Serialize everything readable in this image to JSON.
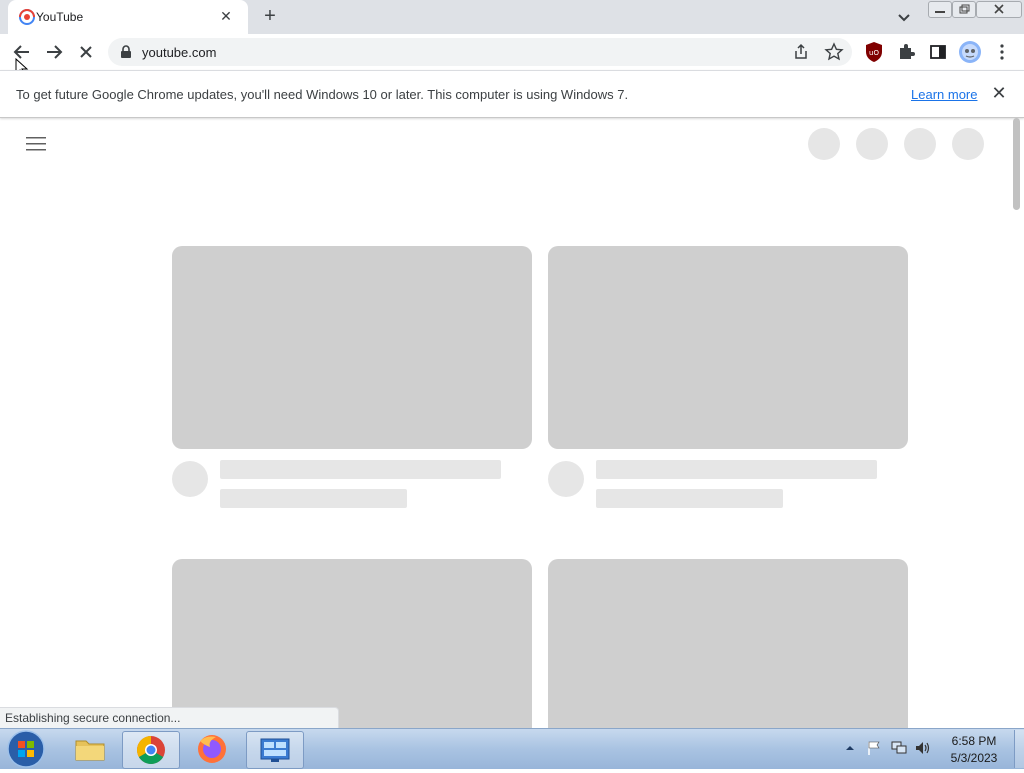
{
  "browser": {
    "tab_title": "YouTube",
    "tab_close": "✕",
    "new_tab": "+",
    "url": "youtube.com"
  },
  "infobar": {
    "message": "To get future Google Chrome updates, you'll need Windows 10 or later. This computer is using Windows 7.",
    "link": "Learn more",
    "close": "✕"
  },
  "status_bar": {
    "text": "Establishing secure connection..."
  },
  "taskbar": {
    "time": "6:58 PM",
    "date": "5/3/2023",
    "apps": [
      "start-orb",
      "file-explorer",
      "google-chrome",
      "firefox",
      "control-panel"
    ]
  },
  "colors": {
    "accent": "#1a73e8",
    "skeleton": "#cfcfcf",
    "skeleton_light": "#e6e6e6"
  }
}
